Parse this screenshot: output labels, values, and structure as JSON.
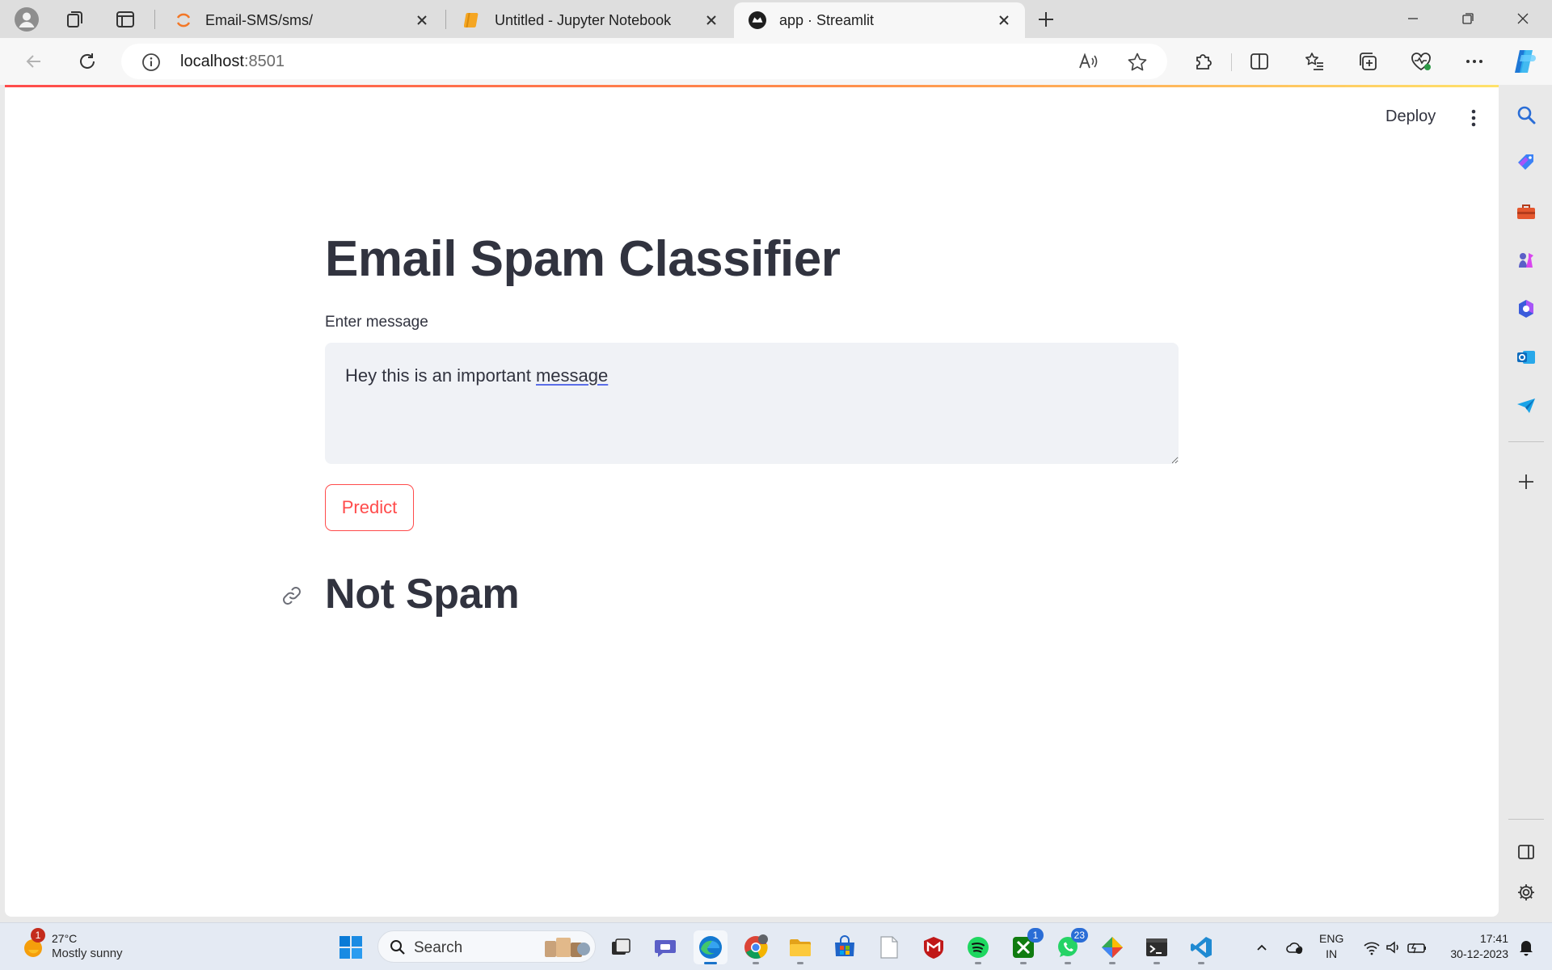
{
  "browser": {
    "tabs": [
      {
        "title": "Email-SMS/sms/",
        "active": false
      },
      {
        "title": "Untitled - Jupyter Notebook",
        "active": false
      },
      {
        "title": "app · Streamlit",
        "active": true
      }
    ],
    "address": {
      "host": "localhost",
      "port": ":8501"
    }
  },
  "app": {
    "deploy_label": "Deploy",
    "title": "Email Spam Classifier",
    "input_label": "Enter message",
    "input_value_before": "Hey this is an important ",
    "input_value_flagged": "message",
    "predict_label": "Predict",
    "result": "Not Spam"
  },
  "taskbar": {
    "weather": {
      "badge": "1",
      "temp": "27°C",
      "condition": "Mostly sunny"
    },
    "search_label": "Search",
    "badges": {
      "xbox": "1",
      "whatsapp": "23"
    },
    "lang_line1": "ENG",
    "lang_line2": "IN",
    "time": "17:41",
    "date": "30-12-2023"
  },
  "colors": {
    "accent": "#ff4b4b",
    "text": "#31333f",
    "input_bg": "#f0f2f6",
    "taskbar_active": "#1a73c9"
  }
}
